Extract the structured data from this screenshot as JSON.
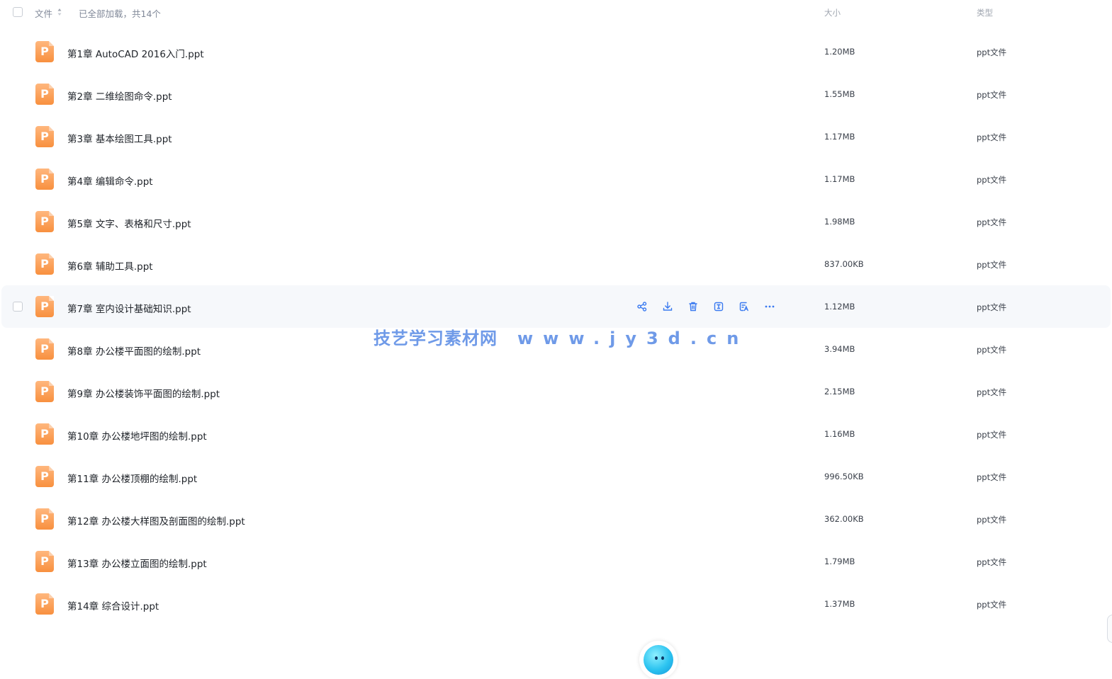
{
  "header": {
    "file_label": "文件",
    "status": "已全部加载，共14个",
    "size_label": "大小",
    "type_label": "类型",
    "sort_icon": "sort-caret-icon"
  },
  "files": [
    {
      "name": "第1章 AutoCAD 2016入门.ppt",
      "size": "1.20MB",
      "type": "ppt文件"
    },
    {
      "name": "第2章 二维绘图命令.ppt",
      "size": "1.55MB",
      "type": "ppt文件"
    },
    {
      "name": "第3章 基本绘图工具.ppt",
      "size": "1.17MB",
      "type": "ppt文件"
    },
    {
      "name": "第4章 编辑命令.ppt",
      "size": "1.17MB",
      "type": "ppt文件"
    },
    {
      "name": "第5章 文字、表格和尺寸.ppt",
      "size": "1.98MB",
      "type": "ppt文件"
    },
    {
      "name": "第6章 辅助工具.ppt",
      "size": "837.00KB",
      "type": "ppt文件"
    },
    {
      "name": "第7章 室内设计基础知识.ppt",
      "size": "1.12MB",
      "type": "ppt文件"
    },
    {
      "name": "第8章 办公楼平面图的绘制.ppt",
      "size": "3.94MB",
      "type": "ppt文件"
    },
    {
      "name": "第9章 办公楼装饰平面图的绘制.ppt",
      "size": "2.15MB",
      "type": "ppt文件"
    },
    {
      "name": "第10章 办公楼地坪图的绘制.ppt",
      "size": "1.16MB",
      "type": "ppt文件"
    },
    {
      "name": "第11章 办公楼顶棚的绘制.ppt",
      "size": "996.50KB",
      "type": "ppt文件"
    },
    {
      "name": "第12章 办公楼大样图及剖面图的绘制.ppt",
      "size": "362.00KB",
      "type": "ppt文件"
    },
    {
      "name": "第13章 办公楼立面图的绘制.ppt",
      "size": "1.79MB",
      "type": "ppt文件"
    },
    {
      "name": "第14章 综合设计.ppt",
      "size": "1.37MB",
      "type": "ppt文件"
    }
  ],
  "hover_row_index": 6,
  "row_actions": [
    "share-icon",
    "download-icon",
    "delete-icon",
    "rename-icon",
    "ai-assistant-icon",
    "more-icon"
  ],
  "file_icon": {
    "name": "ppt-file-icon",
    "letter": "P",
    "color": "#f8903f"
  },
  "watermark": {
    "cn": "技艺学习素材网",
    "url": "www.jy3d.cn"
  },
  "colors": {
    "accent": "#3a7af0",
    "hover_bg": "#f6f8fb",
    "text": "#1f2329",
    "muted": "#818999"
  },
  "mascot_icon": "assistant-mascot-icon"
}
